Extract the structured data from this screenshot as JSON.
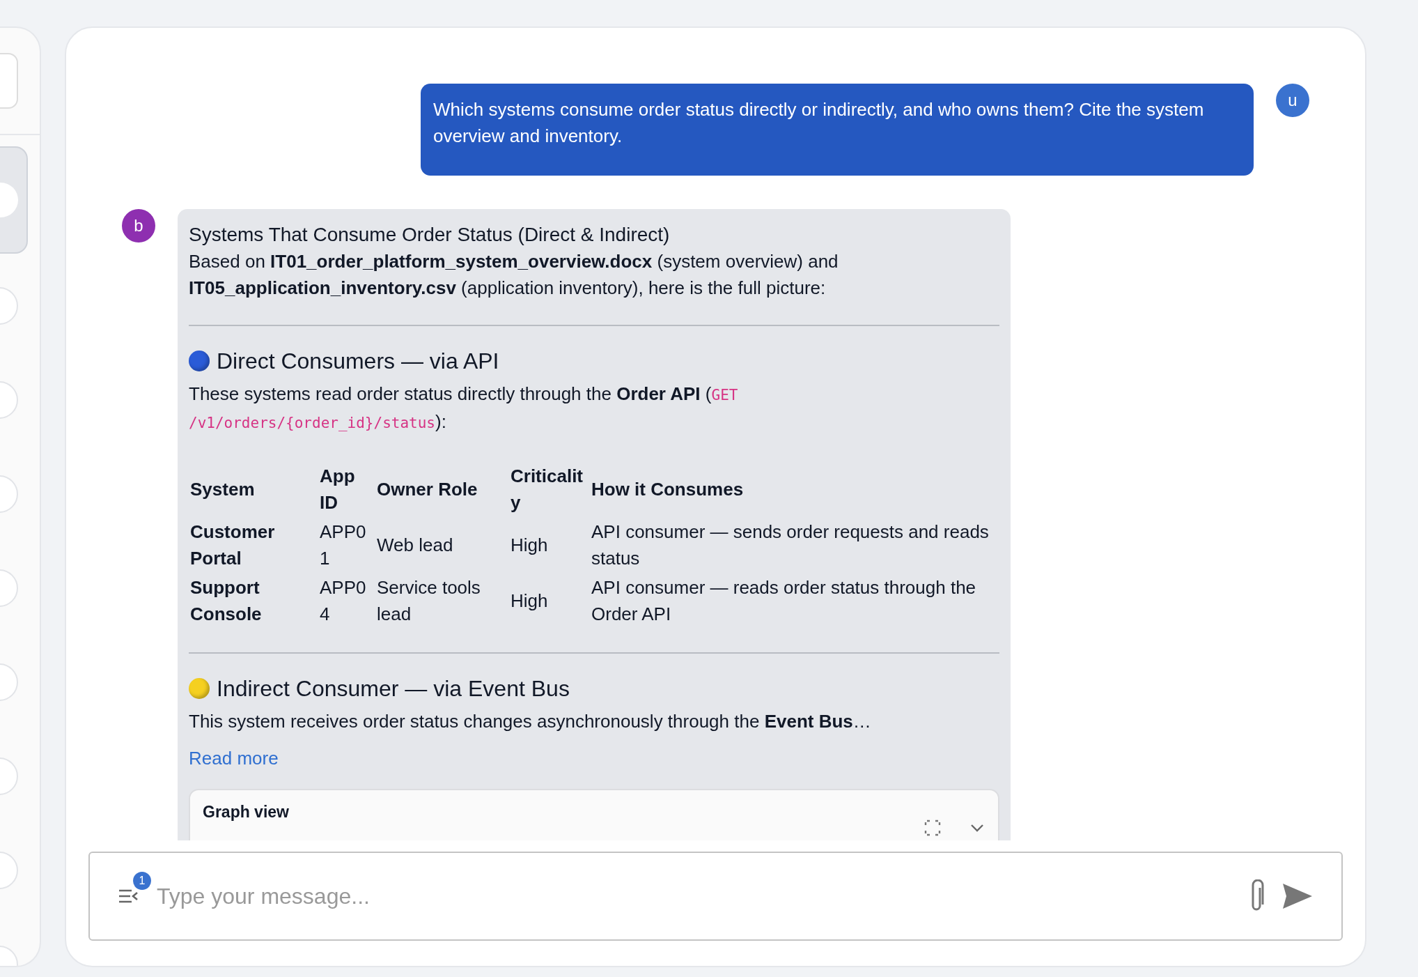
{
  "sidebar": {
    "items": [
      {
        "selected": true
      },
      {
        "selected": false
      },
      {
        "selected": false
      },
      {
        "selected": false
      },
      {
        "selected": false
      },
      {
        "selected": false
      },
      {
        "selected": false
      },
      {
        "selected": false
      },
      {
        "selected": false
      }
    ]
  },
  "messages": [
    {
      "kind": "user",
      "avatar": "u",
      "text": "Which systems consume order status directly or indirectly, and who owns them? Cite the system overview and inventory."
    },
    {
      "kind": "bot",
      "avatar": "b",
      "title": "Systems That Consume Order Status (Direct & Indirect)",
      "intro": "Based on **IT01_order_platform_system_overview.docx** (system overview) and **IT05_application_inventory.csv** (application inventory), here is the full picture:",
      "sections": [
        {
          "heading": "Direct Consumers — via API",
          "color": "#2a5bd7",
          "text_before": "These systems read order status directly through the **Order API** (",
          "code": "GET /v1/orders/{order_id}/status",
          "text_after": "):",
          "table": {
            "columns": [
              "System",
              "App ID",
              "Owner Role",
              "Criticality",
              "How it Consumes"
            ],
            "rows": [
              [
                "Customer Portal",
                "APP01",
                "Web lead",
                "High",
                "API consumer — sends order requests and reads status"
              ],
              [
                "Support Console",
                "APP04",
                "Service tools lead",
                "High",
                "API consumer — reads order status through the Order API"
              ]
            ]
          }
        },
        {
          "heading": "Indirect Consumer — via Event Bus",
          "color": "#f5d020",
          "text_before": "This system receives order status changes asynchronously through the **Event Bus**…"
        }
      ],
      "read_more": "Read more",
      "graph_title": "Graph view"
    }
  ],
  "composer": {
    "placeholder": "Type your message...",
    "badge": "1"
  }
}
